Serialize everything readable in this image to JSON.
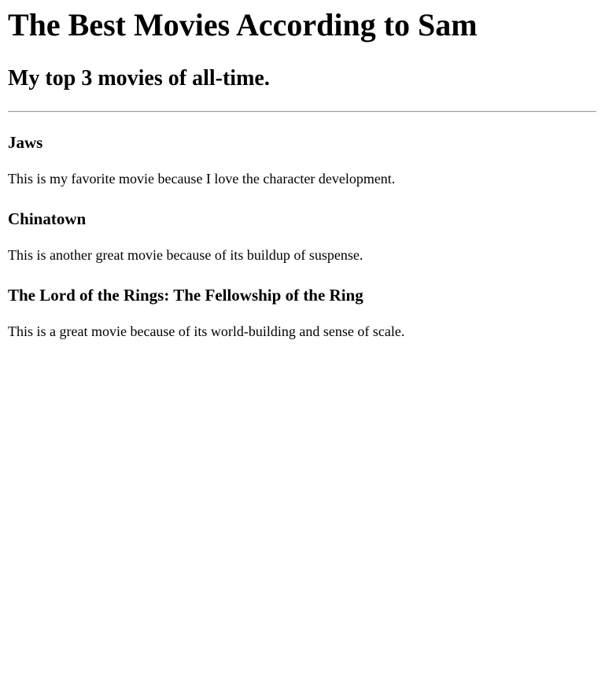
{
  "page": {
    "title": "The Best Movies According to Sam",
    "subtitle": "My top 3 movies of all-time."
  },
  "movies": [
    {
      "title": "Jaws",
      "reason": "This is my favorite movie because I love the character development."
    },
    {
      "title": "Chinatown",
      "reason": "This is another great movie because of its buildup of suspense."
    },
    {
      "title": "The Lord of the Rings: The Fellowship of the Ring",
      "reason": "This is a great movie because of its world-building and sense of scale."
    }
  ],
  "colors": {
    "background": "#ffffff",
    "text": "#000000",
    "divider": "#9a9a9a"
  }
}
